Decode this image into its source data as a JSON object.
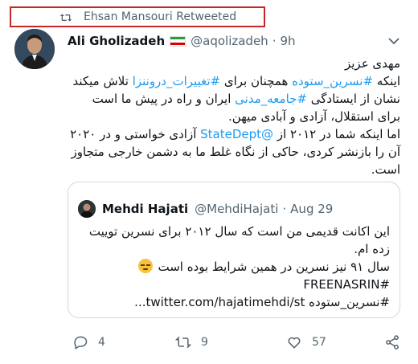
{
  "retweet": {
    "text": "Ehsan Mansouri Retweeted",
    "icon": "retweet-icon"
  },
  "tweet": {
    "author_name": "Ali Gholizadeh",
    "handle": "@aqolizadeh",
    "separator": "·",
    "time": "9h",
    "flag_colors": [
      "#239f40",
      "#ffffff",
      "#da0000"
    ],
    "body": {
      "line1": "مهدی عزیز",
      "line2_pre": "اینکه ",
      "line2_tag1": "#نسرین_ستوده",
      "line2_mid": " همچنان برای ",
      "line2_tag2": "#تغییرات_دروننزا",
      "line2_post": " تلاش میکند",
      "line3_pre": "نشان از ایستادگی ",
      "line3_tag": "#جامعه_مدنی",
      "line3_post": " ایران و راه در پیش ما است",
      "line4": "برای استقلال، آزادی و آبادی میهن.",
      "line5_pre": "اما اینکه شما در ۲۰۱۲ از ",
      "line5_link": "@StateDept",
      "line5_post": " آزادی خواستی و در ۲۰۲۰",
      "line6": "آن را بازنشر کردی، حاکی از نگاه غلط ما به دشمن خارجی متجاوز",
      "line7": "است."
    }
  },
  "quote": {
    "author_name": "Mehdi Hajati",
    "handle": "@MehdiHajati",
    "separator": "·",
    "date": "Aug 29",
    "line1": "این اکانت قدیمی من است که سال ۲۰۱۲ برای نسرین توییت",
    "line2": "زده ام.",
    "line3": "سال ۹۱ نیز نسرین در همین شرایط بوده است",
    "line4": "#FREENASRIN",
    "line5": "#نسرین_ستوده twitter.com/hajatimehdi/st..."
  },
  "actions": {
    "replies": "4",
    "retweets": "9",
    "likes": "57"
  },
  "colors": {
    "link": "#1d9bf0",
    "muted": "#536471",
    "highlight_border": "#c62828"
  }
}
